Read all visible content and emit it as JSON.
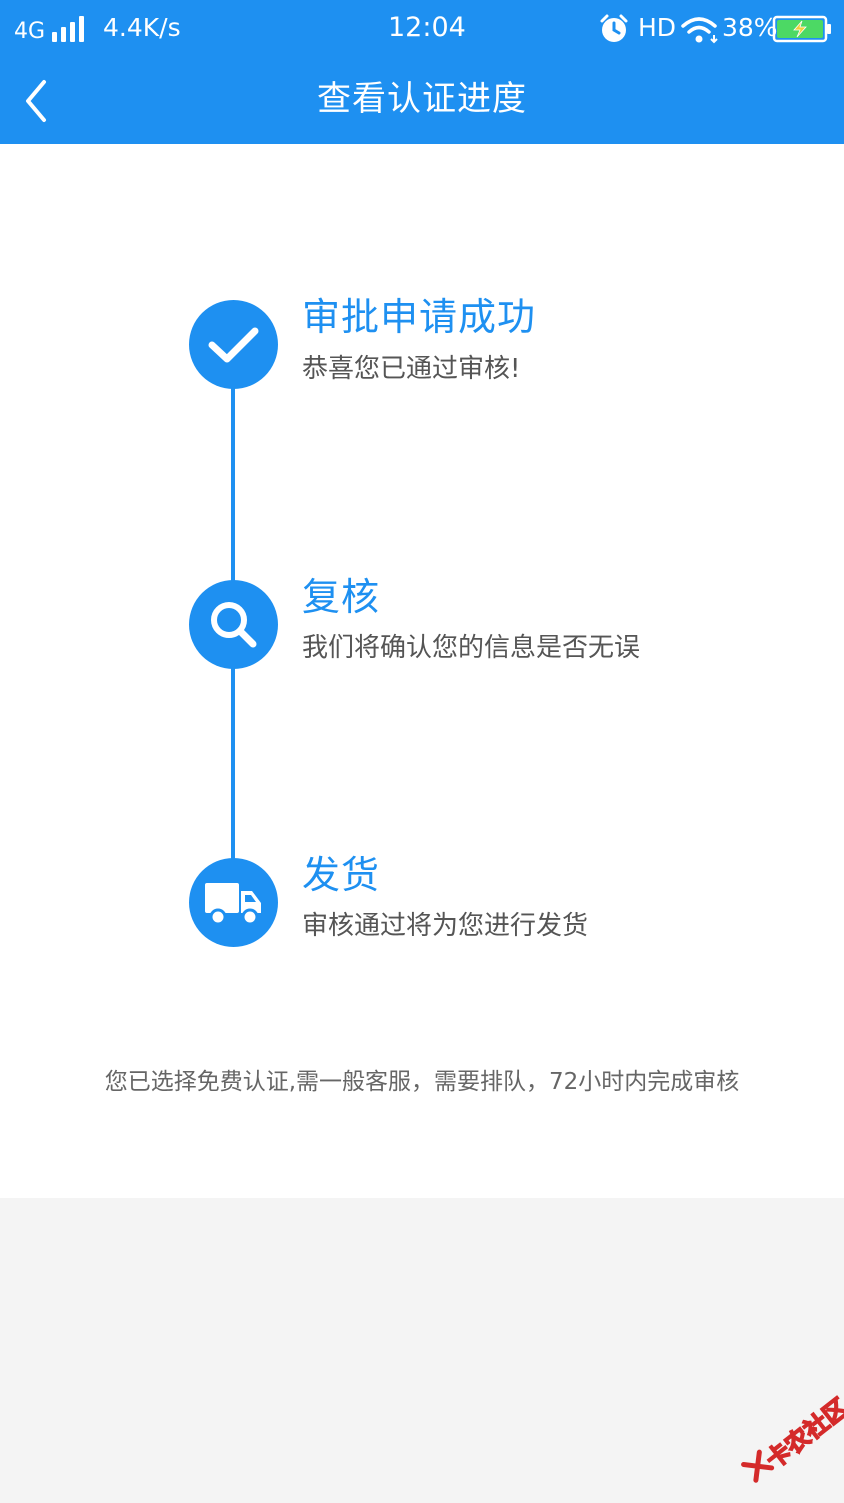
{
  "status_bar": {
    "network": "4G",
    "speed": "4.4K/s",
    "time": "12:04",
    "hd": "HD",
    "battery": "38%"
  },
  "nav": {
    "title": "查看认证进度"
  },
  "steps": [
    {
      "title": "审批申请成功",
      "desc": "恭喜您已通过审核!",
      "icon": "check-icon"
    },
    {
      "title": "复核",
      "desc": "我们将确认您的信息是否无误",
      "icon": "search-icon"
    },
    {
      "title": "发货",
      "desc": "审核通过将为您进行发货",
      "icon": "truck-icon"
    }
  ],
  "notice": "您已选择免费认证,需一般客服，需要排队，72小时内完成审核",
  "watermark": "卡农社区",
  "colors": {
    "primary": "#1e90f1",
    "background": "#f4f4f4",
    "battery_charging": "#4cd964"
  }
}
